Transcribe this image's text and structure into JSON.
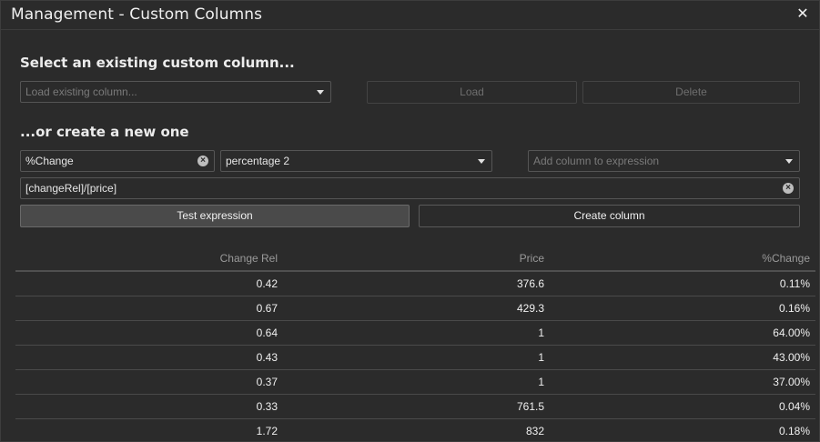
{
  "window": {
    "title": "Management - Custom Columns",
    "close_glyph": "✕"
  },
  "existing": {
    "heading": "Select an existing custom column...",
    "select_placeholder": "Load existing column...",
    "load_label": "Load",
    "delete_label": "Delete"
  },
  "create": {
    "heading": "...or create a new one",
    "name_value": "%Change",
    "format_value": "percentage 2",
    "add_column_placeholder": "Add column to expression",
    "expression_value": "[changeRel]/[price]",
    "test_label": "Test expression",
    "create_label": "Create column"
  },
  "table": {
    "headers": [
      "Change Rel",
      "Price",
      "%Change"
    ],
    "rows": [
      [
        "0.42",
        "376.6",
        "0.11%"
      ],
      [
        "0.67",
        "429.3",
        "0.16%"
      ],
      [
        "0.64",
        "1",
        "64.00%"
      ],
      [
        "0.43",
        "1",
        "43.00%"
      ],
      [
        "0.37",
        "1",
        "37.00%"
      ],
      [
        "0.33",
        "761.5",
        "0.04%"
      ],
      [
        "1.72",
        "832",
        "0.18%"
      ]
    ]
  }
}
